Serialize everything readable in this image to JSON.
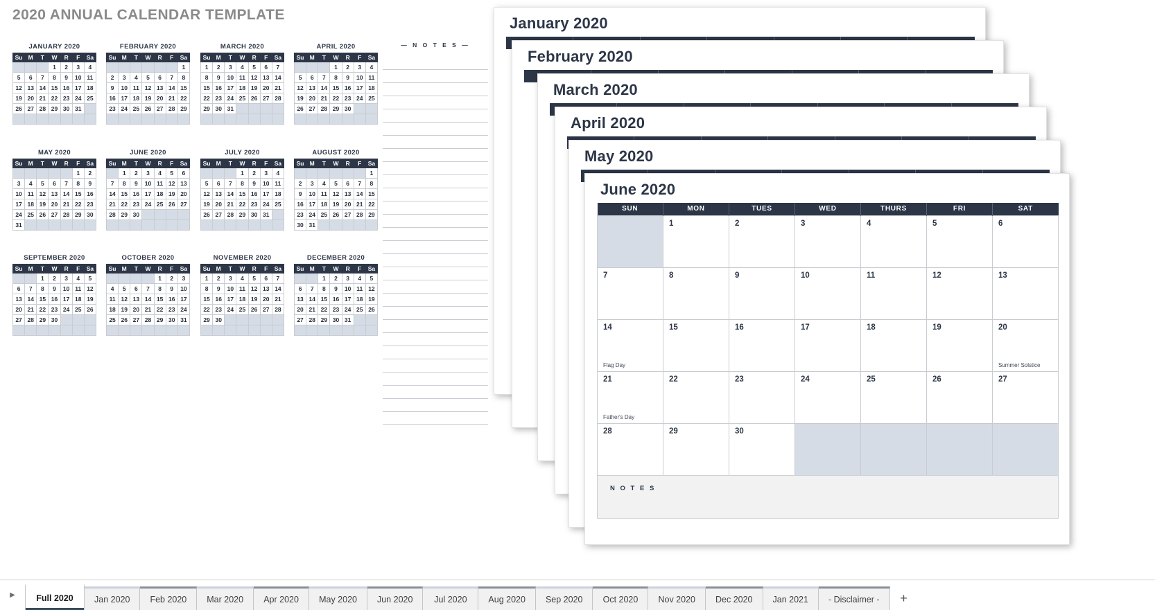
{
  "page_title": "2020 ANNUAL CALENDAR TEMPLATE",
  "colors": {
    "header_navy": "#2c3647",
    "off_day": "#d5dce6",
    "title_grey": "#8a8a8a",
    "grid_line": "#c9ccd1"
  },
  "mini_calendars": {
    "weekday_headers": [
      "Su",
      "M",
      "T",
      "W",
      "R",
      "F",
      "Sa"
    ],
    "months": [
      {
        "title": "JANUARY 2020",
        "weeks": [
          [
            "",
            "",
            "",
            "1",
            "2",
            "3",
            "4"
          ],
          [
            "5",
            "6",
            "7",
            "8",
            "9",
            "10",
            "11"
          ],
          [
            "12",
            "13",
            "14",
            "15",
            "16",
            "17",
            "18"
          ],
          [
            "19",
            "20",
            "21",
            "22",
            "23",
            "24",
            "25"
          ],
          [
            "26",
            "27",
            "28",
            "29",
            "30",
            "31",
            ""
          ],
          [
            "",
            "",
            "",
            "",
            "",
            "",
            ""
          ]
        ]
      },
      {
        "title": "FEBRUARY 2020",
        "weeks": [
          [
            "",
            "",
            "",
            "",
            "",
            "",
            "1"
          ],
          [
            "2",
            "3",
            "4",
            "5",
            "6",
            "7",
            "8"
          ],
          [
            "9",
            "10",
            "11",
            "12",
            "13",
            "14",
            "15"
          ],
          [
            "16",
            "17",
            "18",
            "19",
            "20",
            "21",
            "22"
          ],
          [
            "23",
            "24",
            "25",
            "26",
            "27",
            "28",
            "29"
          ],
          [
            "",
            "",
            "",
            "",
            "",
            "",
            ""
          ]
        ]
      },
      {
        "title": "MARCH 2020",
        "weeks": [
          [
            "1",
            "2",
            "3",
            "4",
            "5",
            "6",
            "7"
          ],
          [
            "8",
            "9",
            "10",
            "11",
            "12",
            "13",
            "14"
          ],
          [
            "15",
            "16",
            "17",
            "18",
            "19",
            "20",
            "21"
          ],
          [
            "22",
            "23",
            "24",
            "25",
            "26",
            "27",
            "28"
          ],
          [
            "29",
            "30",
            "31",
            "",
            "",
            "",
            ""
          ],
          [
            "",
            "",
            "",
            "",
            "",
            "",
            ""
          ]
        ]
      },
      {
        "title": "APRIL 2020",
        "weeks": [
          [
            "",
            "",
            "",
            "1",
            "2",
            "3",
            "4"
          ],
          [
            "5",
            "6",
            "7",
            "8",
            "9",
            "10",
            "11"
          ],
          [
            "12",
            "13",
            "14",
            "15",
            "16",
            "17",
            "18"
          ],
          [
            "19",
            "20",
            "21",
            "22",
            "23",
            "24",
            "25"
          ],
          [
            "26",
            "27",
            "28",
            "29",
            "30",
            "",
            ""
          ],
          [
            "",
            "",
            "",
            "",
            "",
            "",
            ""
          ]
        ]
      },
      {
        "title": "MAY 2020",
        "weeks": [
          [
            "",
            "",
            "",
            "",
            "",
            "1",
            "2"
          ],
          [
            "3",
            "4",
            "5",
            "6",
            "7",
            "8",
            "9"
          ],
          [
            "10",
            "11",
            "12",
            "13",
            "14",
            "15",
            "16"
          ],
          [
            "17",
            "18",
            "19",
            "20",
            "21",
            "22",
            "23"
          ],
          [
            "24",
            "25",
            "26",
            "27",
            "28",
            "29",
            "30"
          ],
          [
            "31",
            "",
            "",
            "",
            "",
            "",
            ""
          ]
        ]
      },
      {
        "title": "JUNE 2020",
        "weeks": [
          [
            "",
            "1",
            "2",
            "3",
            "4",
            "5",
            "6"
          ],
          [
            "7",
            "8",
            "9",
            "10",
            "11",
            "12",
            "13"
          ],
          [
            "14",
            "15",
            "16",
            "17",
            "18",
            "19",
            "20"
          ],
          [
            "21",
            "22",
            "23",
            "24",
            "25",
            "26",
            "27"
          ],
          [
            "28",
            "29",
            "30",
            "",
            "",
            "",
            ""
          ],
          [
            "",
            "",
            "",
            "",
            "",
            "",
            ""
          ]
        ]
      },
      {
        "title": "JULY 2020",
        "weeks": [
          [
            "",
            "",
            "",
            "1",
            "2",
            "3",
            "4"
          ],
          [
            "5",
            "6",
            "7",
            "8",
            "9",
            "10",
            "11"
          ],
          [
            "12",
            "13",
            "14",
            "15",
            "16",
            "17",
            "18"
          ],
          [
            "19",
            "20",
            "21",
            "22",
            "23",
            "24",
            "25"
          ],
          [
            "26",
            "27",
            "28",
            "29",
            "30",
            "31",
            ""
          ],
          [
            "",
            "",
            "",
            "",
            "",
            "",
            ""
          ]
        ]
      },
      {
        "title": "AUGUST 2020",
        "weeks": [
          [
            "",
            "",
            "",
            "",
            "",
            "",
            "1"
          ],
          [
            "2",
            "3",
            "4",
            "5",
            "6",
            "7",
            "8"
          ],
          [
            "9",
            "10",
            "11",
            "12",
            "13",
            "14",
            "15"
          ],
          [
            "16",
            "17",
            "18",
            "19",
            "20",
            "21",
            "22"
          ],
          [
            "23",
            "24",
            "25",
            "26",
            "27",
            "28",
            "29"
          ],
          [
            "30",
            "31",
            "",
            "",
            "",
            "",
            ""
          ]
        ]
      },
      {
        "title": "SEPTEMBER 2020",
        "weeks": [
          [
            "",
            "",
            "1",
            "2",
            "3",
            "4",
            "5"
          ],
          [
            "6",
            "7",
            "8",
            "9",
            "10",
            "11",
            "12"
          ],
          [
            "13",
            "14",
            "15",
            "16",
            "17",
            "18",
            "19"
          ],
          [
            "20",
            "21",
            "22",
            "23",
            "24",
            "25",
            "26"
          ],
          [
            "27",
            "28",
            "29",
            "30",
            "",
            "",
            ""
          ],
          [
            "",
            "",
            "",
            "",
            "",
            "",
            ""
          ]
        ]
      },
      {
        "title": "OCTOBER 2020",
        "weeks": [
          [
            "",
            "",
            "",
            "",
            "1",
            "2",
            "3"
          ],
          [
            "4",
            "5",
            "6",
            "7",
            "8",
            "9",
            "10"
          ],
          [
            "11",
            "12",
            "13",
            "14",
            "15",
            "16",
            "17"
          ],
          [
            "18",
            "19",
            "20",
            "21",
            "22",
            "23",
            "24"
          ],
          [
            "25",
            "26",
            "27",
            "28",
            "29",
            "30",
            "31"
          ],
          [
            "",
            "",
            "",
            "",
            "",
            "",
            ""
          ]
        ]
      },
      {
        "title": "NOVEMBER 2020",
        "weeks": [
          [
            "1",
            "2",
            "3",
            "4",
            "5",
            "6",
            "7"
          ],
          [
            "8",
            "9",
            "10",
            "11",
            "12",
            "13",
            "14"
          ],
          [
            "15",
            "16",
            "17",
            "18",
            "19",
            "20",
            "21"
          ],
          [
            "22",
            "23",
            "24",
            "25",
            "26",
            "27",
            "28"
          ],
          [
            "29",
            "30",
            "",
            "",
            "",
            "",
            ""
          ],
          [
            "",
            "",
            "",
            "",
            "",
            "",
            ""
          ]
        ]
      },
      {
        "title": "DECEMBER 2020",
        "weeks": [
          [
            "",
            "",
            "1",
            "2",
            "3",
            "4",
            "5"
          ],
          [
            "6",
            "7",
            "8",
            "9",
            "10",
            "11",
            "12"
          ],
          [
            "13",
            "14",
            "15",
            "16",
            "17",
            "18",
            "19"
          ],
          [
            "20",
            "21",
            "22",
            "23",
            "24",
            "25",
            "26"
          ],
          [
            "27",
            "28",
            "29",
            "30",
            "31",
            "",
            ""
          ],
          [
            "",
            "",
            "",
            "",
            "",
            "",
            ""
          ]
        ]
      }
    ]
  },
  "notes_left": {
    "header": "—  N O T E S  —",
    "line_count": 28
  },
  "month_cards": {
    "weekday_headers": [
      "SUN",
      "MON",
      "TUES",
      "WED",
      "THURS",
      "FRI",
      "SAT"
    ],
    "stack": [
      {
        "title": "January 2020"
      },
      {
        "title": "February 2020"
      },
      {
        "title": "March 2020"
      },
      {
        "title": "April 2020"
      },
      {
        "title": "May 2020"
      }
    ],
    "front": {
      "title": "June 2020",
      "notes_label": "N O T E S",
      "weeks": [
        [
          {
            "day": "",
            "off": true
          },
          {
            "day": "1"
          },
          {
            "day": "2"
          },
          {
            "day": "3"
          },
          {
            "day": "4"
          },
          {
            "day": "5"
          },
          {
            "day": "6"
          }
        ],
        [
          {
            "day": "7"
          },
          {
            "day": "8"
          },
          {
            "day": "9"
          },
          {
            "day": "10"
          },
          {
            "day": "11"
          },
          {
            "day": "12"
          },
          {
            "day": "13"
          }
        ],
        [
          {
            "day": "14",
            "event": "Flag Day"
          },
          {
            "day": "15"
          },
          {
            "day": "16"
          },
          {
            "day": "17"
          },
          {
            "day": "18"
          },
          {
            "day": "19"
          },
          {
            "day": "20",
            "event": "Summer Solstice"
          }
        ],
        [
          {
            "day": "21",
            "event": "Father's Day"
          },
          {
            "day": "22"
          },
          {
            "day": "23"
          },
          {
            "day": "24"
          },
          {
            "day": "25"
          },
          {
            "day": "26"
          },
          {
            "day": "27"
          }
        ],
        [
          {
            "day": "28"
          },
          {
            "day": "29"
          },
          {
            "day": "30"
          },
          {
            "day": "",
            "off": true
          },
          {
            "day": "",
            "off": true
          },
          {
            "day": "",
            "off": true
          },
          {
            "day": "",
            "off": true
          }
        ]
      ]
    }
  },
  "tabbar": {
    "nav_icon": "play-right-icon",
    "add_label": "+",
    "tabs": [
      {
        "label": "Full 2020",
        "active": true
      },
      {
        "label": "Jan 2020",
        "active": false
      },
      {
        "label": "Feb 2020",
        "active": false
      },
      {
        "label": "Mar 2020",
        "active": false
      },
      {
        "label": "Apr 2020",
        "active": false
      },
      {
        "label": "May 2020",
        "active": false
      },
      {
        "label": "Jun 2020",
        "active": false
      },
      {
        "label": "Jul 2020",
        "active": false
      },
      {
        "label": "Aug 2020",
        "active": false
      },
      {
        "label": "Sep 2020",
        "active": false
      },
      {
        "label": "Oct 2020",
        "active": false
      },
      {
        "label": "Nov 2020",
        "active": false
      },
      {
        "label": "Dec 2020",
        "active": false
      },
      {
        "label": "Jan 2021",
        "active": false
      },
      {
        "label": "- Disclaimer -",
        "active": false
      }
    ]
  }
}
